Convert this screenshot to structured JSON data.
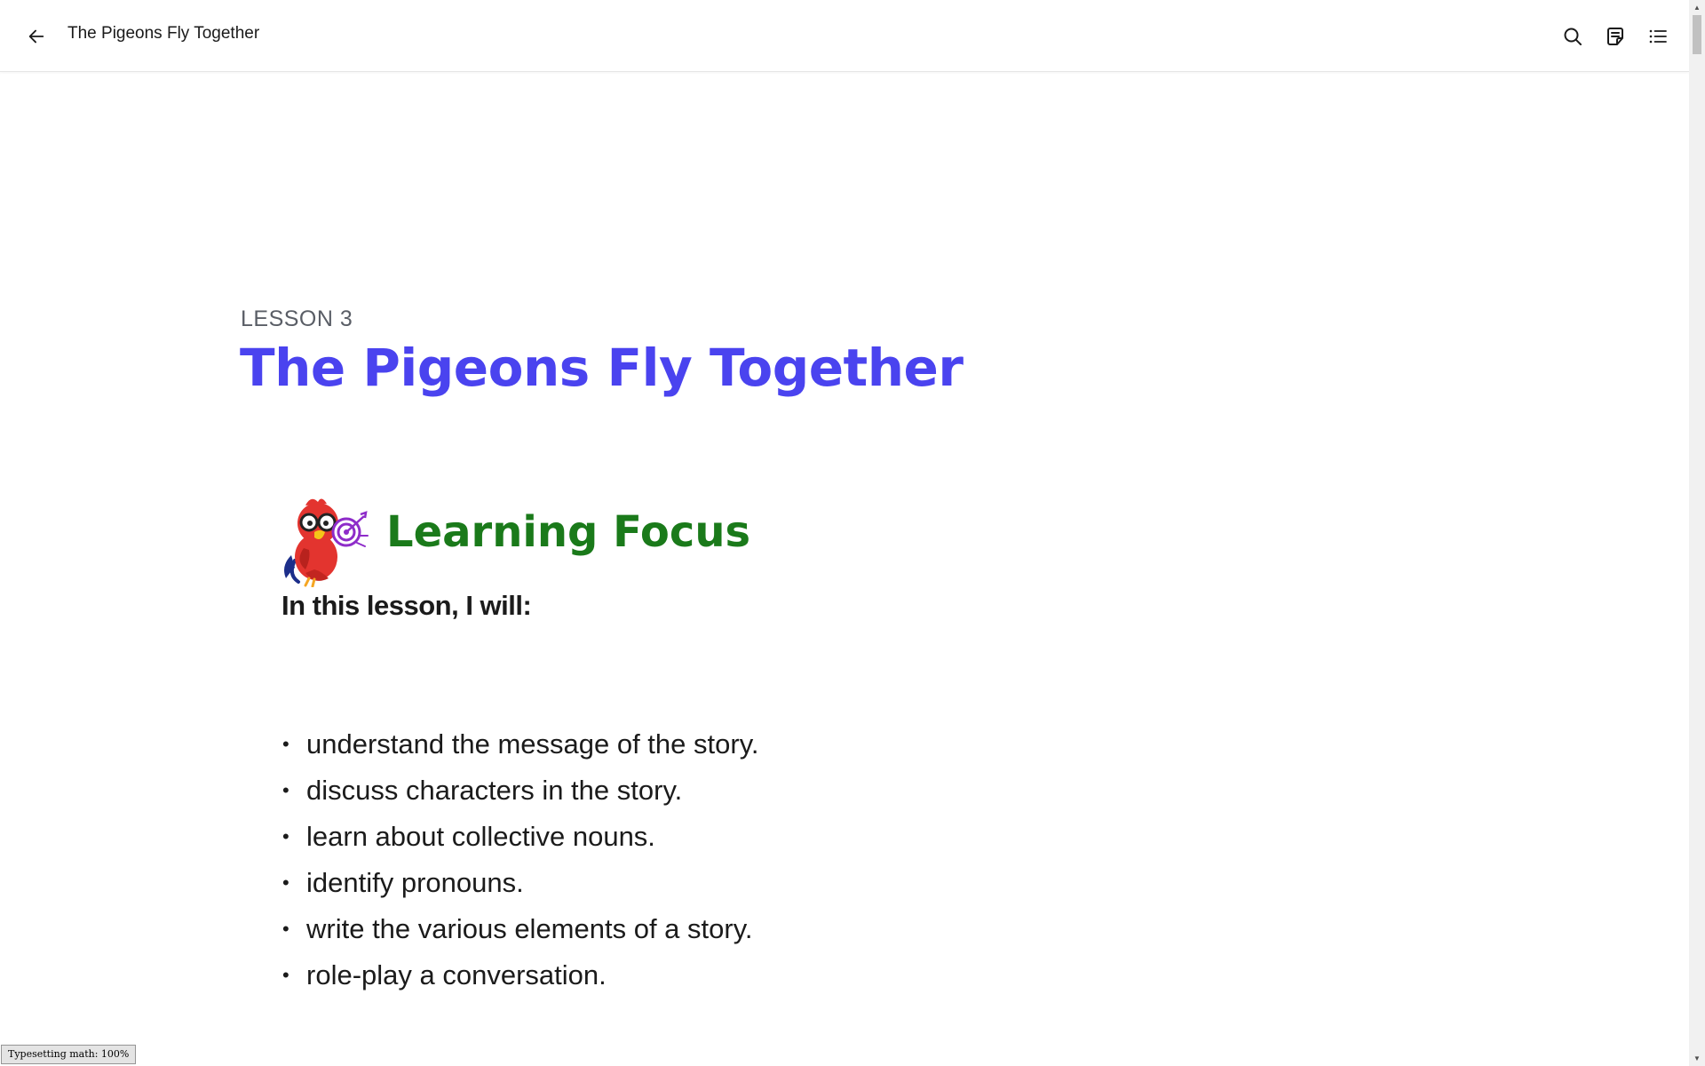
{
  "header": {
    "title": "The Pigeons Fly Together",
    "back_icon": "arrow-left-icon",
    "actions": [
      {
        "name": "search",
        "icon": "search-icon"
      },
      {
        "name": "notes",
        "icon": "notes-icon"
      },
      {
        "name": "contents",
        "icon": "list-icon"
      }
    ]
  },
  "lesson": {
    "label": "LESSON 3",
    "title": "The Pigeons Fly Together"
  },
  "learning_focus": {
    "heading": "Learning Focus",
    "mascot": "parrot-mascot-icon",
    "intro": "In this lesson, I will:",
    "bullet": "•",
    "items": [
      "understand the message of the story.",
      "discuss characters in the story.",
      "learn about collective nouns.",
      "identify pronouns.",
      "write the various elements of a story.",
      "role-play a conversation."
    ]
  },
  "status": {
    "text": "Typesetting math: 100%"
  },
  "colors": {
    "title": "#4a43ef",
    "focus_heading": "#1a7a1a",
    "lesson_label": "#5a5e66"
  }
}
